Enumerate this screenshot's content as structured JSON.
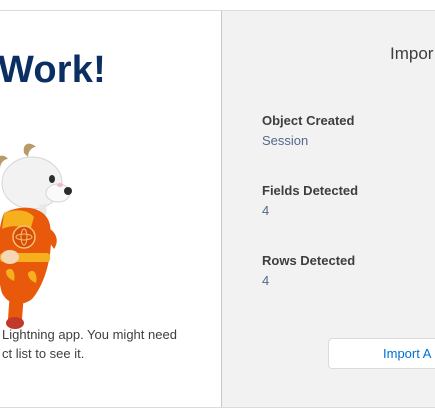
{
  "left": {
    "heading": "Work!",
    "message_line1": "Lightning app. You might need",
    "message_line2": "ct list to see it."
  },
  "right": {
    "title": "Impor",
    "stats": [
      {
        "label": "Object Created",
        "value": "Session"
      },
      {
        "label": "Fields Detected",
        "value": "4"
      },
      {
        "label": "Rows Detected",
        "value": "4"
      }
    ],
    "button_label": "Import A"
  },
  "icons": {
    "mascot": "goat-mascot-icon"
  },
  "colors": {
    "heading": "#0b2f63",
    "link": "#0070d2",
    "panel_bg": "#f3f2f2"
  }
}
